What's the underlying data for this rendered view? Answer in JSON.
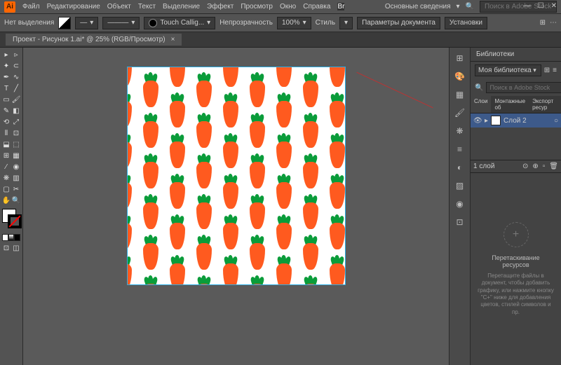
{
  "menu": {
    "items": [
      "Файл",
      "Редактирование",
      "Объект",
      "Текст",
      "Выделение",
      "Эффект",
      "Просмотр",
      "Окно",
      "Справка"
    ],
    "workspace": "Основные сведения",
    "search_placeholder": "Поиск в Adobe Stock"
  },
  "options": {
    "no_selection": "Нет выделения",
    "brush": "Touch Callig...",
    "opacity_label": "Непрозрачность",
    "opacity_value": "100%",
    "style_label": "Стиль",
    "doc_params": "Параметры документа",
    "setup": "Установки"
  },
  "document": {
    "tab_title": "Проект - Рисунок 1.ai* @ 25% (RGB/Просмотр)"
  },
  "panels": {
    "libraries_title": "Библиотеки",
    "library_select": "Моя библиотека",
    "lib_search_placeholder": "Поиск в Adobe Stock",
    "layers_tabs": [
      "Слои",
      "Монтажные об",
      "Экспорт ресур"
    ],
    "layer_name": "Слой 2",
    "layer_count": "1 слой",
    "drop_title": "Перетаскивание ресурсов",
    "drop_text": "Перетащите файлы в документ, чтобы добавить графику, или нажмите кнопку \"С+\" ниже для добавления цветов, стилей символов и пр."
  }
}
